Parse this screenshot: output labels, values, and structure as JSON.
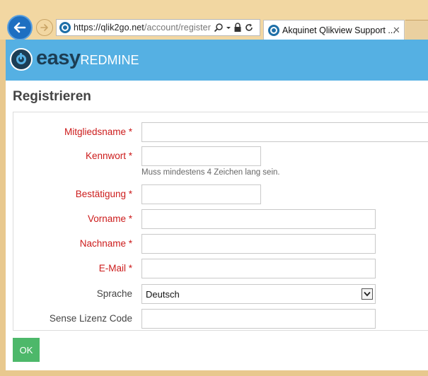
{
  "browser": {
    "url_host": "https://qlik2go.net",
    "url_path": "/account/register",
    "tab_title": "Akquinet Qlikview Support ...",
    "tab_close": "✕"
  },
  "app": {
    "logo_easy": "easy",
    "logo_redmine": "REDMINE"
  },
  "page": {
    "title": "Registrieren"
  },
  "form": {
    "login_label": "Mitgliedsname *",
    "password_label": "Kennwort *",
    "password_hint": "Muss mindestens 4 Zeichen lang sein.",
    "confirmation_label": "Bestätigung *",
    "firstname_label": "Vorname *",
    "lastname_label": "Nachname *",
    "email_label": "E-Mail *",
    "language_label": "Sprache",
    "language_value": "Deutsch",
    "license_label": "Sense Lizenz Code",
    "submit_label": "OK"
  },
  "colors": {
    "header_bar": "#55b0e3",
    "required_label": "#cc1b1b",
    "submit_button": "#4db86a",
    "browser_frame": "#f2d7a2"
  },
  "icons": [
    "back-arrow-icon",
    "forward-arrow-icon",
    "site-favicon-icon",
    "search-icon",
    "dropdown-arrow-icon",
    "lock-icon",
    "refresh-icon",
    "close-icon",
    "easyredmine-logo-icon",
    "chevron-down-icon"
  ]
}
